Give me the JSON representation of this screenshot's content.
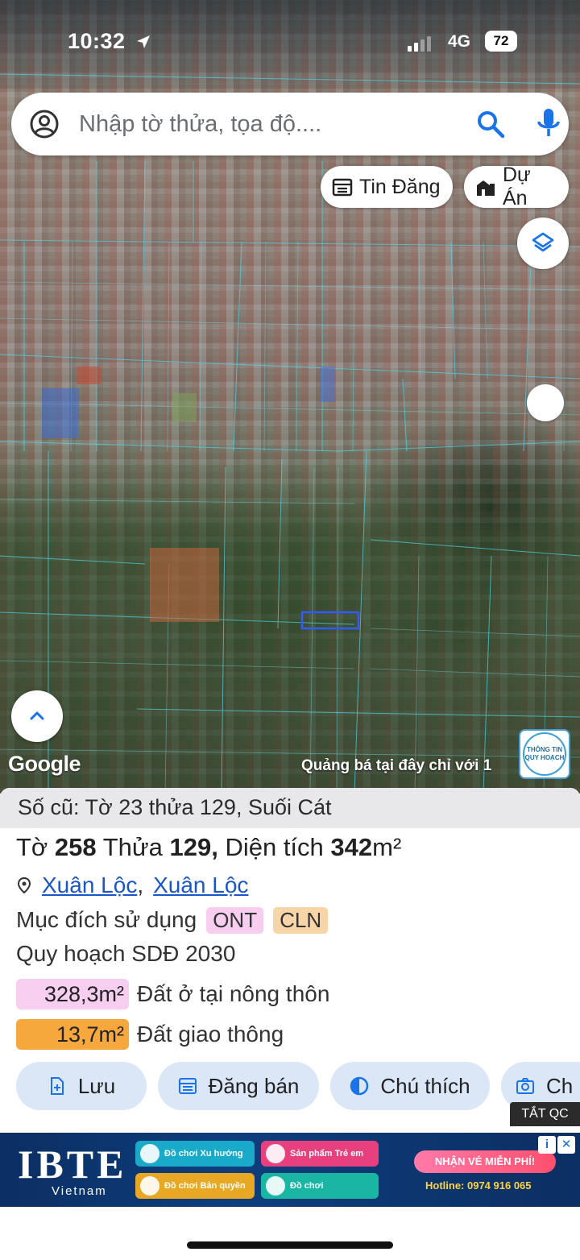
{
  "status": {
    "time": "10:32",
    "network": "4G",
    "battery": "72"
  },
  "search": {
    "placeholder": "Nhập tờ thửa, tọa độ...."
  },
  "chips": {
    "listings": "Tin Đăng",
    "projects": "Dự Án"
  },
  "map": {
    "attribution": "Google",
    "promo": "Quảng bá tại đây chỉ với 1",
    "badge_line1": "THÔNG TIN",
    "badge_line2": "QUY HOẠCH"
  },
  "parcel": {
    "old_number": "Số cũ: Tờ 23 thửa 129, Suối Cát",
    "sheet_label": "Tờ",
    "sheet": "258",
    "plot_label": "Thửa",
    "plot": "129,",
    "area_label": "Diện tích",
    "area": "342",
    "area_unit": "m²",
    "location_commune": "Xuân Lộc",
    "location_comma": ",",
    "location_district": "Xuân Lộc",
    "purpose_label": "Mục đích sử dụng",
    "purpose_tags": [
      "ONT",
      "CLN"
    ],
    "plan_title": "Quy hoạch SDĐ 2030",
    "plan_items": [
      {
        "area": "328,3m²",
        "label": "Đất ở tại nông thôn",
        "color": "#f7cdf0"
      },
      {
        "area": "13,7m²",
        "label": "Đất giao thông",
        "color": "#f6a83c"
      }
    ]
  },
  "actions": {
    "save": "Lưu",
    "post_sale": "Đăng bán",
    "legend": "Chú thích",
    "capture": "Ch"
  },
  "ad": {
    "close_label": "TẮT QC",
    "brand": "IBTE",
    "brand_sub": "Vietnam",
    "pill_1": "Đồ chơi Xu hướng",
    "pill_2": "Sản phẩm Trẻ em",
    "pill_3": "Đồ chơi Bản quyền",
    "pill_4": "Đồ chơi",
    "cta": "NHẬN VÉ MIỄN PHÍ!",
    "hotline": "Hotline: 0974 916 065",
    "info": "i",
    "close_x": "✕"
  },
  "colors": {
    "accent_blue": "#1a73e8",
    "action_bg": "#dbe6f7",
    "parcel_outline": "#2f5cff"
  }
}
